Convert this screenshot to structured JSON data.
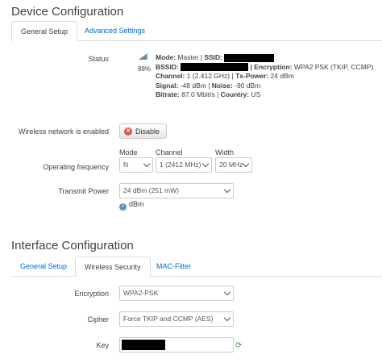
{
  "device": {
    "title": "Device Configuration",
    "tabs": [
      "General Setup",
      "Advanced Settings"
    ],
    "status_label": "Status",
    "signal_pct": "88%",
    "status": {
      "mode_k": "Mode:",
      "mode_v": "Master |",
      "ssid_k": "SSID:",
      "bssid_k": "BSSID:",
      "enc_k": "| Encryption:",
      "enc_v": "WPA2 PSK (TKIP, CCMP)",
      "chan_k": "Channel:",
      "chan_v": "1 (2.412 GHz) |",
      "txp_k": "Tx-Power:",
      "txp_v": "24 dBm",
      "sig_k": "Signal:",
      "sig_v": "-48 dBm |",
      "noise_k": "Noise:",
      "noise_v": "-90 dBm",
      "bit_k": "Bitrate:",
      "bit_v": "87.0 Mbit/s |",
      "country_k": "Country:",
      "country_v": "US"
    },
    "wireless_enabled_label": "Wireless network is enabled",
    "disable_button": "Disable",
    "freq_label": "Operating frequency",
    "mode_hdr": "Mode",
    "channel_hdr": "Channel",
    "width_hdr": "Width",
    "mode_value": "N",
    "channel_value": "1 (2412 MHz)",
    "width_value": "20 MHz",
    "txpower_label": "Transmit Power",
    "txpower_value": "24 dBm (251 mW)",
    "dbm_hint": "dBm"
  },
  "iface": {
    "title": "Interface Configuration",
    "tabs": [
      "General Setup",
      "Wireless Security",
      "MAC-Filter"
    ],
    "encryption_label": "Encryption",
    "encryption_value": "WPA2-PSK",
    "cipher_label": "Cipher",
    "cipher_value": "Force TKIP and CCMP (AES)",
    "key_label": "Key"
  },
  "colors": {
    "link": "#0069d6",
    "border": "#dddddd",
    "disable_icon": "#d9534f",
    "refresh_icon": "#3a9a3a"
  }
}
